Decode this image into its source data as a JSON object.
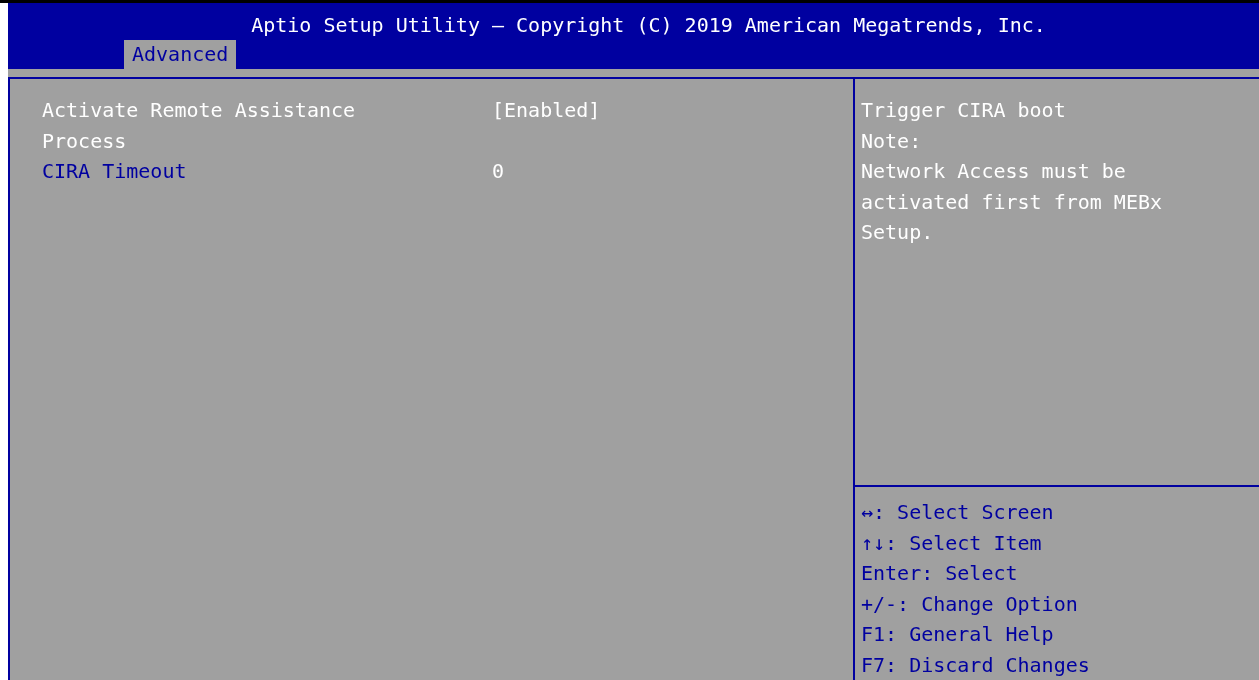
{
  "window": {
    "title": "Aptio Setup Utility – Copyright (C) 2019 American Megatrends, Inc."
  },
  "tabs": [
    {
      "label": "Advanced",
      "selected": true
    }
  ],
  "settings": [
    {
      "label": "Activate Remote Assistance Process",
      "value": "[Enabled]",
      "selected": true
    },
    {
      "label": "CIRA Timeout",
      "value": "0",
      "selected": false
    }
  ],
  "help_text": [
    "Trigger CIRA boot",
    "Note:",
    "Network Access must be activated first from MEBx Setup."
  ],
  "key_help": [
    "↔: Select Screen",
    "↑↓: Select Item",
    "Enter: Select",
    "+/-: Change Option",
    "F1: General Help",
    "F7: Discard Changes"
  ]
}
